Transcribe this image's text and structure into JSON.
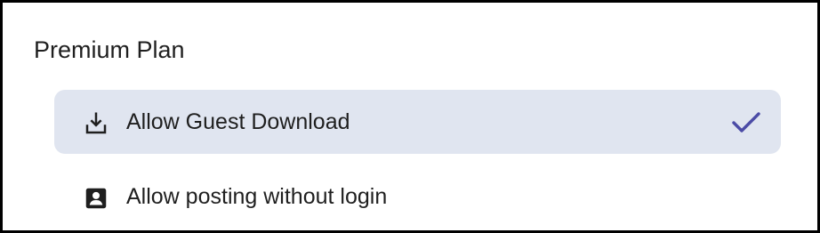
{
  "section": {
    "title": "Premium Plan"
  },
  "options": [
    {
      "label": "Allow Guest Download",
      "icon": "download-icon",
      "selected": true
    },
    {
      "label": "Allow posting without login",
      "icon": "account-box-icon",
      "selected": false
    }
  ],
  "colors": {
    "selected_background": "#e0e5f0",
    "check_accent": "#4b4ba6",
    "text": "#1f1f1f",
    "border": "#000000"
  }
}
